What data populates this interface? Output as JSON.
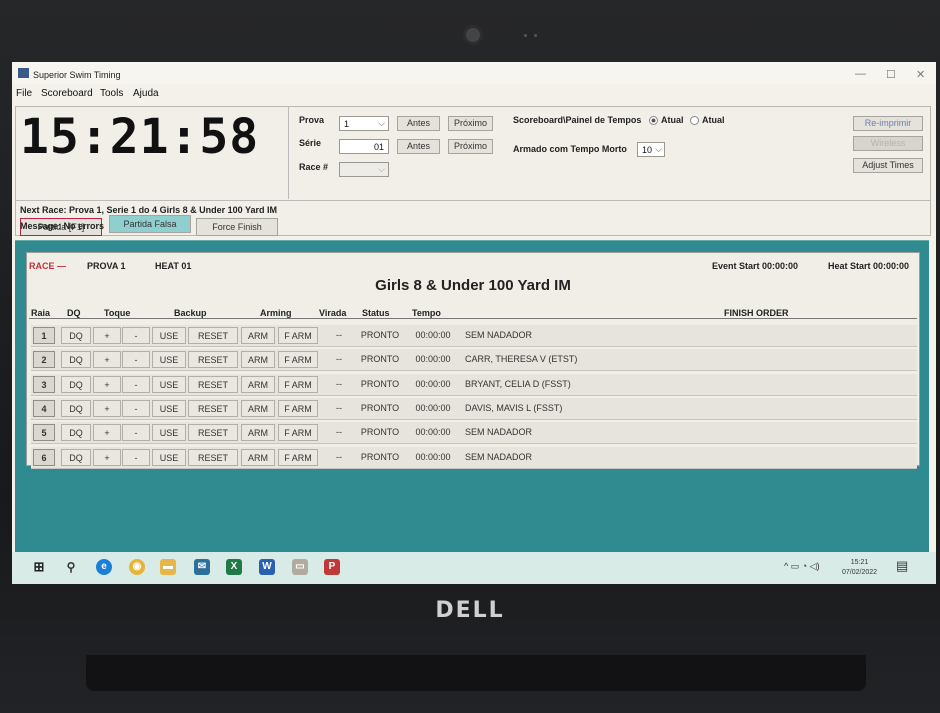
{
  "window": {
    "title": "Superior Swim Timing"
  },
  "menu": [
    "File",
    "Scoreboard",
    "Tools",
    "Ajuda"
  ],
  "clock": "15:21:58",
  "start_buttons": {
    "partida": "Partida [F1]",
    "partida_falsa": "Partida Falsa",
    "force_finish": "Force Finish"
  },
  "controls": {
    "prova_label": "Prova",
    "prova_value": "1",
    "serie_label": "Série",
    "serie_value": "01",
    "race_label": "Race #",
    "race_value": "",
    "antes": "Antes",
    "proximo": "Próximo",
    "scoreboard_label": "Scoreboard\\Painel de Tempos",
    "radio_atual_1": "Atual",
    "radio_atual_2": "Atual",
    "armado_label": "Armado com Tempo Morto",
    "armado_value": "10"
  },
  "side_buttons": {
    "reimprimir": "Re-imprimir",
    "wireless": "Wireless",
    "adjust_times": "Adjust Times"
  },
  "next_race": "Next Race: Prova 1, Serie 1 do 4 Girls 8 & Under 100 Yard IM",
  "message": "Message: No errors",
  "race": {
    "race_label": "RACE —",
    "prova_label": "PROVA",
    "prova_value": "1",
    "heat_label": "HEAT",
    "heat_value": "01",
    "event_start": "Event Start 00:00:00",
    "heat_start": "Heat Start 00:00:00",
    "title": "Girls 8 & Under 100 Yard IM",
    "columns": {
      "raia": "Raia",
      "dq": "DQ",
      "toque": "Toque",
      "backup": "Backup",
      "arming": "Arming",
      "virada": "Virada",
      "status": "Status",
      "tempo": "Tempo",
      "finish_order": "FINISH ORDER"
    },
    "button_labels": {
      "dq": "DQ",
      "plus": "+",
      "minus": "-",
      "use": "USE",
      "reset": "RESET",
      "arm": "ARM",
      "farm": "F ARM",
      "virada": "--"
    },
    "lanes": [
      {
        "lane": "1",
        "status": "PRONTO",
        "tempo": "00:00:00",
        "swimmer": "SEM NADADOR"
      },
      {
        "lane": "2",
        "status": "PRONTO",
        "tempo": "00:00:00",
        "swimmer": "CARR, THERESA V (ETST)"
      },
      {
        "lane": "3",
        "status": "PRONTO",
        "tempo": "00:00:00",
        "swimmer": "BRYANT, CELIA D (FSST)"
      },
      {
        "lane": "4",
        "status": "PRONTO",
        "tempo": "00:00:00",
        "swimmer": "DAVIS, MAVIS L (FSST)"
      },
      {
        "lane": "5",
        "status": "PRONTO",
        "tempo": "00:00:00",
        "swimmer": "SEM NADADOR"
      },
      {
        "lane": "6",
        "status": "PRONTO",
        "tempo": "00:00:00",
        "swimmer": "SEM NADADOR"
      }
    ]
  },
  "taskbar": {
    "time": "15:21",
    "date": "07/02/2022"
  },
  "laptop_brand": "DELL"
}
